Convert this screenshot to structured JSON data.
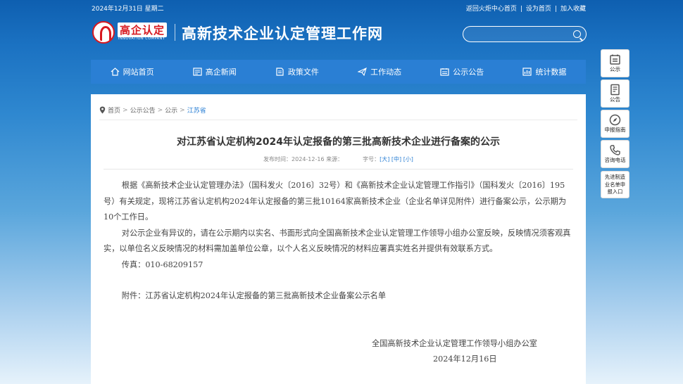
{
  "topbar": {
    "date": "2024年12月31日 星期二",
    "links": [
      "返回火炬中心首页",
      "设为首页",
      "加入收藏"
    ]
  },
  "header": {
    "logo_cn": "高企认定",
    "logo_en": "INNOVATION COMPANY",
    "site_title": "高新技术企业认定管理工作网",
    "search_placeholder": ""
  },
  "nav": [
    {
      "label": "网站首页",
      "icon": "home-icon"
    },
    {
      "label": "高企新闻",
      "icon": "news-icon"
    },
    {
      "label": "政策文件",
      "icon": "document-icon"
    },
    {
      "label": "工作动态",
      "icon": "paper-plane-icon"
    },
    {
      "label": "公示公告",
      "icon": "notice-icon"
    },
    {
      "label": "统计数据",
      "icon": "chart-icon"
    }
  ],
  "breadcrumb": {
    "items": [
      "首页",
      "公示公告",
      "公示"
    ],
    "current": "江苏省"
  },
  "article": {
    "title": "对江苏省认定机构2024年认定报备的第三批高新技术企业进行备案的公示",
    "meta_publish": "发布时间：2024-12-16 来源：",
    "meta_font": "字号：",
    "font_large": "[大]",
    "font_medium": "[中]",
    "font_small": "[小]",
    "para1": "根据《高新技术企业认定管理办法》（国科发火〔2016〕32号）和《高新技术企业认定管理工作指引》（国科发火〔2016〕195号）有关规定，现将江苏省认定机构2024年认定报备的第三批10164家高新技术企业（企业名单详见附件）进行备案公示，公示期为10个工作日。",
    "para2": "对公示企业有异议的，请在公示期内以实名、书面形式向全国高新技术企业认定管理工作领导小组办公室反映，反映情况须客观真实，以单位名义反映情况的材料需加盖单位公章，以个人名义反映情况的材料应署真实姓名并提供有效联系方式。",
    "fax": "传真：010-68209157",
    "attachment": "附件：江苏省认定机构2024年认定报备的第三批高新技术企业备案公示名单",
    "signature": "全国高新技术企业认定管理工作领导小组办公室",
    "sign_date": "2024年12月16日"
  },
  "float_tools": [
    {
      "label": "公示",
      "icon": "notice-board-icon"
    },
    {
      "label": "公告",
      "icon": "announcement-icon"
    },
    {
      "label": "申报指南",
      "icon": "compass-icon"
    },
    {
      "label": "咨询电话",
      "icon": "phone-icon"
    },
    {
      "label": "先进制造业名单申报入口",
      "icon": "none"
    }
  ],
  "colors": {
    "nav_bg": "#2a7fd4",
    "accent_red": "#d71920"
  }
}
